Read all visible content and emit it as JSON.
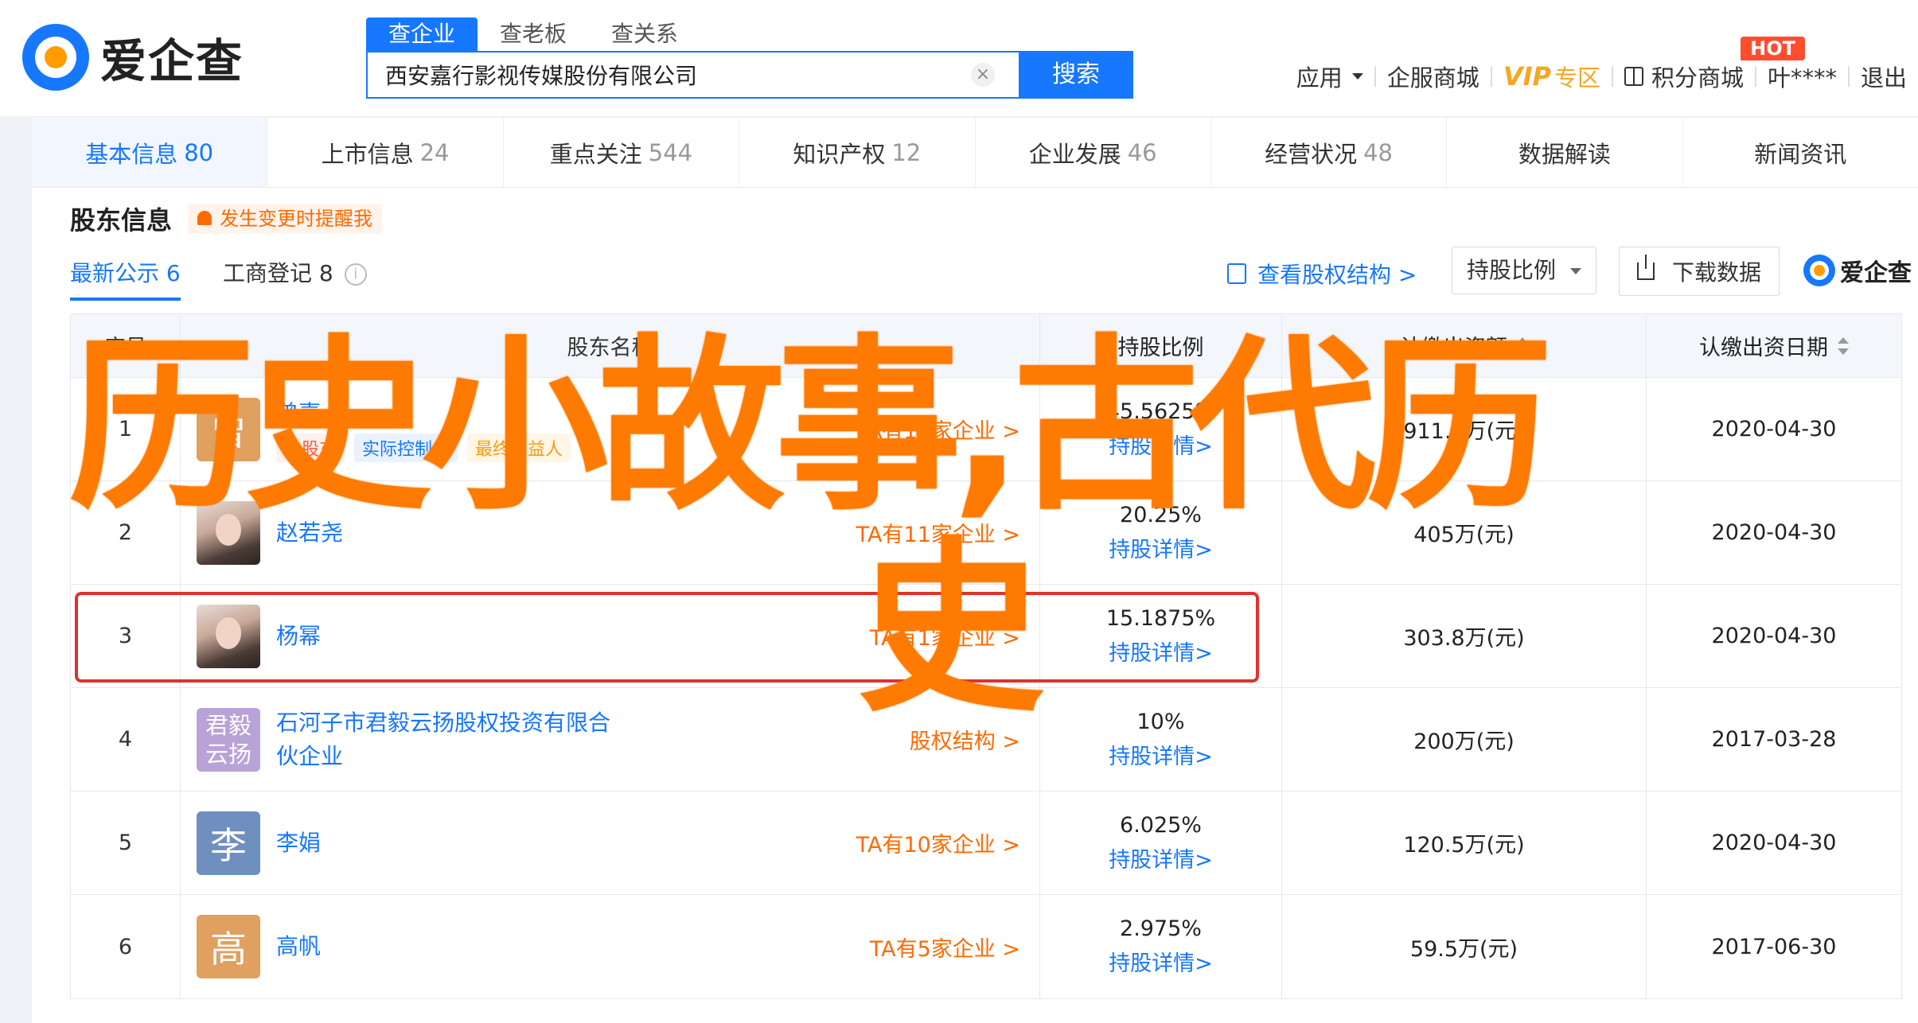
{
  "header": {
    "logo_text": "爱企查",
    "search_tabs": [
      "查企业",
      "查老板",
      "查关系"
    ],
    "search_value": "西安嘉行影视传媒股份有限公司",
    "search_button": "搜索",
    "nav": {
      "app": "应用",
      "service_mall": "企服商城",
      "vip": "VIP",
      "vip_zone": "专区",
      "points_mall": "积分商城",
      "hot": "HOT",
      "user": "叶****",
      "logout": "退出"
    }
  },
  "categories": [
    {
      "label": "基本信息",
      "count": "80"
    },
    {
      "label": "上市信息",
      "count": "24"
    },
    {
      "label": "重点关注",
      "count": "544"
    },
    {
      "label": "知识产权",
      "count": "12"
    },
    {
      "label": "企业发展",
      "count": "46"
    },
    {
      "label": "经营状况",
      "count": "48"
    },
    {
      "label": "数据解读",
      "count": ""
    },
    {
      "label": "新闻资讯",
      "count": ""
    }
  ],
  "section": {
    "title": "股东信息",
    "remind": "发生变更时提醒我",
    "tab_latest": "最新公示 6",
    "tab_registry": "工商登记 8",
    "view_structure": "查看股权结构 >",
    "select_value": "持股比例",
    "download": "下载数据",
    "small_logo": "爱企查"
  },
  "table": {
    "headers": {
      "no": "序号",
      "name": "股东名称",
      "ratio": "持股比例",
      "amount": "认缴出资额",
      "date": "认缴出资日期"
    },
    "detail_label": "持股详情>",
    "rows": [
      {
        "no": "1",
        "avatar": "曾",
        "name": "曾嘉",
        "tags": [
          "大股东",
          "实际控制人",
          "最终受益人"
        ],
        "ta": "TA有16家企业 >",
        "ratio": "45.5625%",
        "amount": "911.3万(元)",
        "date": "2020-04-30"
      },
      {
        "no": "2",
        "avatar": "",
        "name": "赵若尧",
        "tags": [],
        "ta": "TA有11家企业 >",
        "ratio": "20.25%",
        "amount": "405万(元)",
        "date": "2020-04-30"
      },
      {
        "no": "3",
        "avatar": "",
        "name": "杨幂",
        "tags": [],
        "ta": "TA有1家企业 >",
        "ratio": "15.1875%",
        "amount": "303.8万(元)",
        "date": "2020-04-30"
      },
      {
        "no": "4",
        "avatar": "君毅云扬",
        "name": "石河子市君毅云扬股权投资有限合伙企业",
        "tags": [],
        "ta": "股权结构 >",
        "ratio": "10%",
        "amount": "200万(元)",
        "date": "2017-03-28"
      },
      {
        "no": "5",
        "avatar": "李",
        "name": "李娟",
        "tags": [],
        "ta": "TA有10家企业 >",
        "ratio": "6.025%",
        "amount": "120.5万(元)",
        "date": "2020-04-30"
      },
      {
        "no": "6",
        "avatar": "高",
        "name": "高帆",
        "tags": [],
        "ta": "TA有5家企业 >",
        "ratio": "2.975%",
        "amount": "59.5万(元)",
        "date": "2017-06-30"
      }
    ]
  },
  "overlay": {
    "line1": "历史小故事,古代历",
    "line2": "史"
  },
  "colors": {
    "brand_blue": "#1677ff",
    "accent_orange": "#ff7a00",
    "highlight_red": "#e0312e"
  }
}
